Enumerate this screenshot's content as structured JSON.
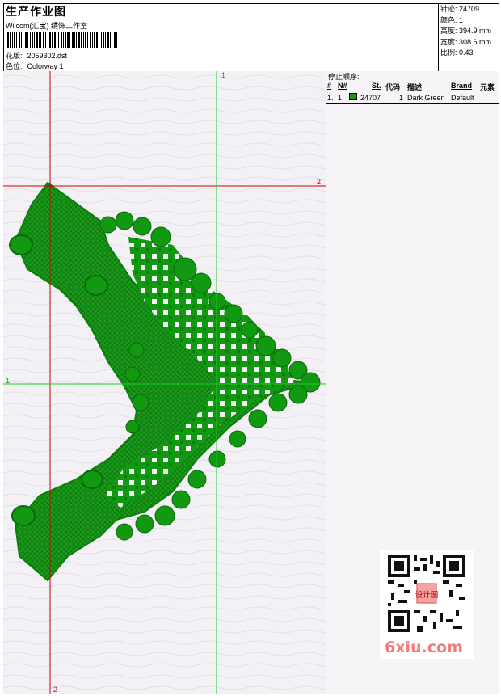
{
  "header": {
    "title": "生产作业图",
    "company": "Wilcom(汇宝) 绣饰工作室",
    "design_label": "花版:",
    "design_value": "2059302.dst",
    "colorway_label": "色位:",
    "colorway_value": "Colorway 1"
  },
  "stats": {
    "stitches": "针迹: 24709",
    "colors": "颜色: 1",
    "height": "高度: 394.9 mm",
    "width": "宽度: 308.6 mm",
    "scale": "比例: 0.43"
  },
  "guides": {
    "top_green": "1",
    "right_red": "2",
    "left_green": "1",
    "bottom_red": "2"
  },
  "sequence": {
    "title": "停止顺序:",
    "columns": [
      "#",
      "N#",
      "St.",
      "代码",
      "描述",
      "Brand",
      "元素"
    ],
    "rows": [
      {
        "index": "1.",
        "needle": "1",
        "stitches": "24707",
        "code": "1",
        "description": "Dark Green",
        "brand": "Default",
        "color": "#119911"
      }
    ]
  },
  "colors": {
    "thread": "#119911",
    "guide_red": "#d20000",
    "guide_green": "#22cc22"
  },
  "watermark": {
    "text": "6xiu.com",
    "badge": "设计图"
  }
}
